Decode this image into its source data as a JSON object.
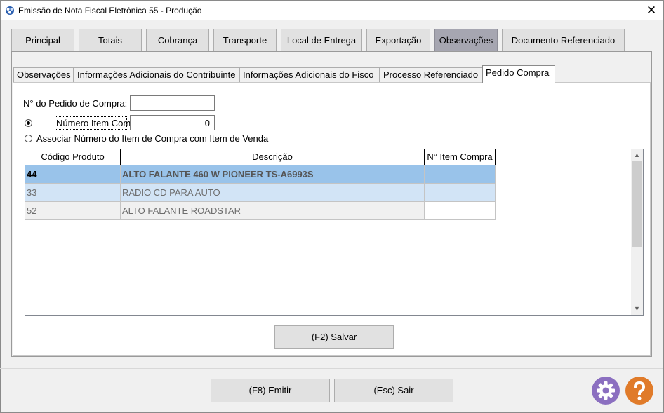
{
  "window": {
    "title": "Emissão de Nota Fiscal Eletrônica 55 - Produção",
    "close": "✕"
  },
  "main_tabs": [
    {
      "label": "Principal"
    },
    {
      "label": "Totais"
    },
    {
      "label": "Cobrança"
    },
    {
      "label": "Transporte"
    },
    {
      "label": "Local de Entrega"
    },
    {
      "label": "Exportação"
    },
    {
      "label": "Observações",
      "active": true
    },
    {
      "label": "Documento Referenciado"
    }
  ],
  "sub_tabs": [
    {
      "label": "Observações"
    },
    {
      "label": "Informações Adicionais do Contribuinte"
    },
    {
      "label": "Informações Adicionais do Fisco"
    },
    {
      "label": "Processo Referenciado"
    },
    {
      "label": "Pedido Compra",
      "active": true
    }
  ],
  "form": {
    "pedido_label": "N° do Pedido de Compra:",
    "pedido_value": "",
    "radio_numero_label": "Número Item Compra",
    "numero_value": "0",
    "radio_associar_label": "Associar Número do Item de Compra com Item de Venda"
  },
  "grid": {
    "headers": [
      "Código Produto",
      "Descrição",
      "N° Item Compra"
    ],
    "rows": [
      {
        "codigo": "44",
        "descricao": "ALTO FALANTE 460 W PIONEER TS-A6993S",
        "item": ""
      },
      {
        "codigo": "33",
        "descricao": "RADIO CD PARA AUTO",
        "item": ""
      },
      {
        "codigo": "52",
        "descricao": "ALTO FALANTE ROADSTAR",
        "item": ""
      }
    ]
  },
  "buttons": {
    "salvar_prefix": "(F2) ",
    "salvar_key": "S",
    "salvar_rest": "alvar",
    "emitir": "(F8) Emitir",
    "sair": "(Esc) Sair"
  },
  "colors": {
    "selected_row": "#99c3ea",
    "alt_row": "#d2e4f6",
    "gear": "#8b6fc0",
    "help": "#e07b2a"
  }
}
